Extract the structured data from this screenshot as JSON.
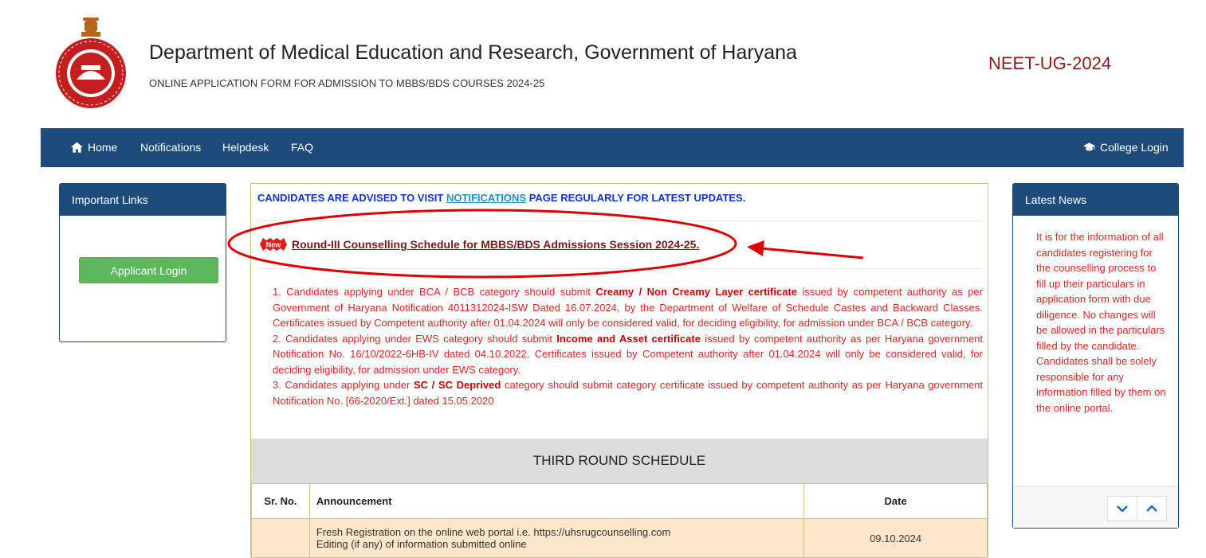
{
  "header": {
    "title": "Department of Medical Education and Research, Government of Haryana",
    "subtitle": "ONLINE APPLICATION FORM FOR ADMISSION TO MBBS/BDS COURSES 2024-25",
    "exam": "NEET-UG-2024"
  },
  "nav": {
    "home": "Home",
    "notifications": "Notifications",
    "helpdesk": "Helpdesk",
    "faq": "FAQ",
    "college_login": "College Login"
  },
  "left_panel": {
    "title": "Important Links",
    "applicant_login": "Applicant Login"
  },
  "main": {
    "advise_prefix": "CANDIDATES ARE ADVISED TO VISIT",
    "advise_link": "NOTIFICATIONS",
    "advise_suffix": "PAGE REGULARLY FOR LATEST UPDATES.",
    "new_badge": "New",
    "news_link": "Round-III Counselling Schedule for MBBS/BDS Admissions Session 2024-25.",
    "notes": [
      {
        "num": "1.",
        "a": "Candidates applying under BCA / BCB category should submit ",
        "b": "Creamy / Non Creamy Layer certificate",
        "c": " issued by competent authority as per Government of Haryana Notification 4011312024-ISW Dated 16.07.2024, by the Department of Welfare of Schedule Castes and Backward Classes. Certificates issued by Competent authority after 01.04.2024 will only be considered valid, for deciding eligibility, for admission under BCA / BCB category."
      },
      {
        "num": "2.",
        "a": "Candidates applying under EWS category should submit ",
        "b": "Income and Asset certificate",
        "c": " issued by competent authority as per Haryana government Notification No. 16/10/2022-6HB-IV dated 04.10.2022. Certificates issued by Competent authority after 01.04.2024 will only be considered valid, for deciding eligibility, for admission under EWS category."
      },
      {
        "num": "3.",
        "a": "Candidates applying under ",
        "b": "SC / SC Deprived",
        "c": " category should submit category certificate issued by competent authority as per Haryana government Notification No. [66-2020/Ext.] dated 15.05.2020"
      }
    ],
    "schedule_title": "THIRD ROUND SCHEDULE",
    "table": {
      "headers": [
        "Sr. No.",
        "Announcement",
        "Date"
      ],
      "rows": [
        {
          "sr": "",
          "announcement_1": "Fresh Registration on the online web portal i.e. https://uhsrugcounselling.com",
          "announcement_2": "Editing (if any) of information submitted online",
          "date": "09.10.2024"
        }
      ]
    }
  },
  "right_panel": {
    "title": "Latest News",
    "text": "It is for the information of all candidates registering for the counselling process to fill up their particulars in application form with due diligence. No changes will be allowed in the particulars filled by the candidate. Candidates shall be solely responsible for any information filled by them on the online portal."
  },
  "colors": {
    "nav_bg": "#1e4c7a",
    "notes_red": "#e02424",
    "exam_maroon": "#8b1a1a",
    "login_green": "#5cb85c",
    "table_row": "#fde6c9"
  },
  "icons": [
    "haryana-emblem-icon",
    "home-icon",
    "graduation-cap-icon",
    "new-badge-icon",
    "chevron-down-icon",
    "chevron-up-icon"
  ]
}
